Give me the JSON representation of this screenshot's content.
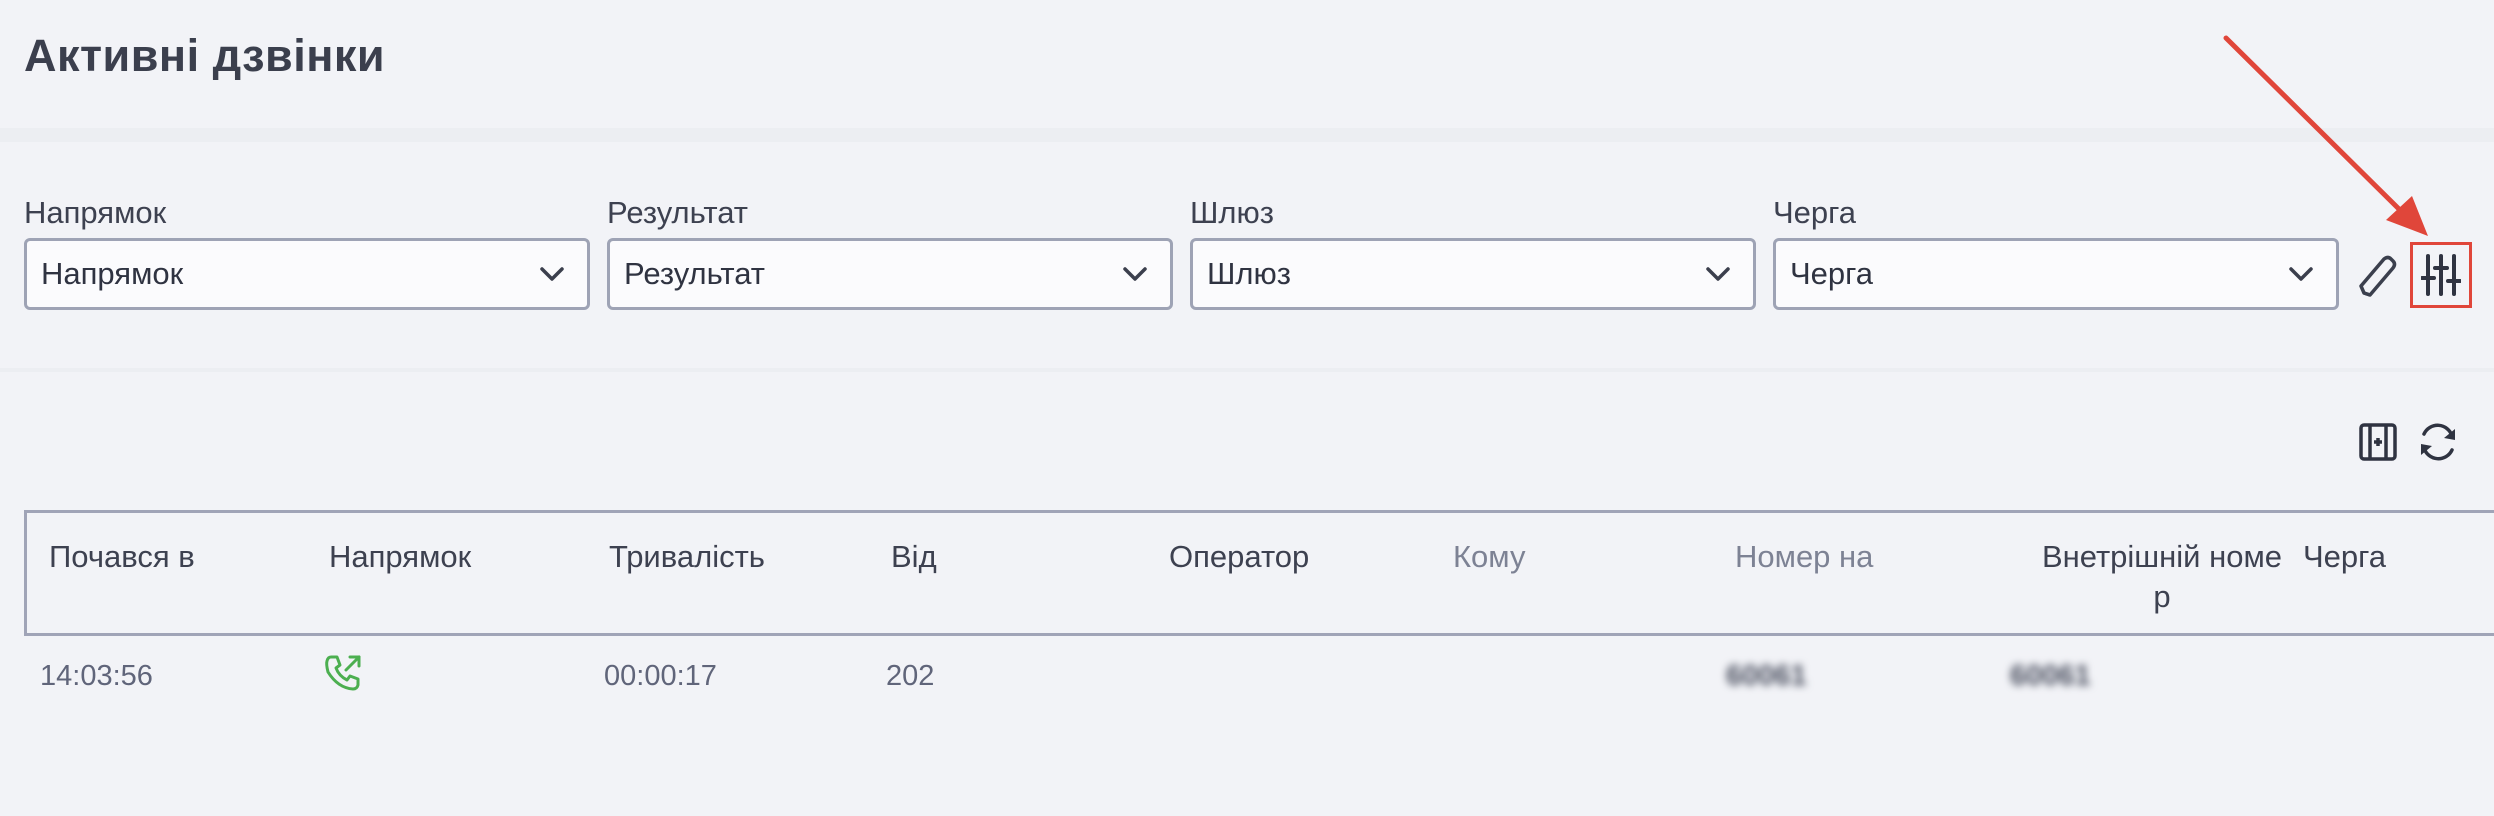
{
  "page": {
    "title": "Активні дзвінки"
  },
  "filters": [
    {
      "label": "Напрямок",
      "value": "Напрямок"
    },
    {
      "label": "Результат",
      "value": "Результат"
    },
    {
      "label": "Шлюз",
      "value": "Шлюз"
    },
    {
      "label": "Черга",
      "value": "Черга"
    }
  ],
  "icons": {
    "edit": "pencil-icon",
    "settings": "sliders-icon",
    "expand": "expand-columns-icon",
    "refresh": "refresh-icon",
    "direction": "outgoing-call-icon"
  },
  "colors": {
    "accent_red": "#e0463a",
    "call_green": "#4caf50"
  },
  "table": {
    "columns": [
      "Почався в",
      "Напрямок",
      "Тривалість",
      "Від",
      "Оператор",
      "Кому",
      "Номер на",
      "Внетрішній номе\nр",
      "Черга"
    ],
    "rows": [
      {
        "started": "14:03:56",
        "direction": "outgoing",
        "duration": "00:00:17",
        "from": "202",
        "operator": "",
        "to": "",
        "number_on": "60061",
        "internal": "60061",
        "queue": ""
      }
    ]
  }
}
